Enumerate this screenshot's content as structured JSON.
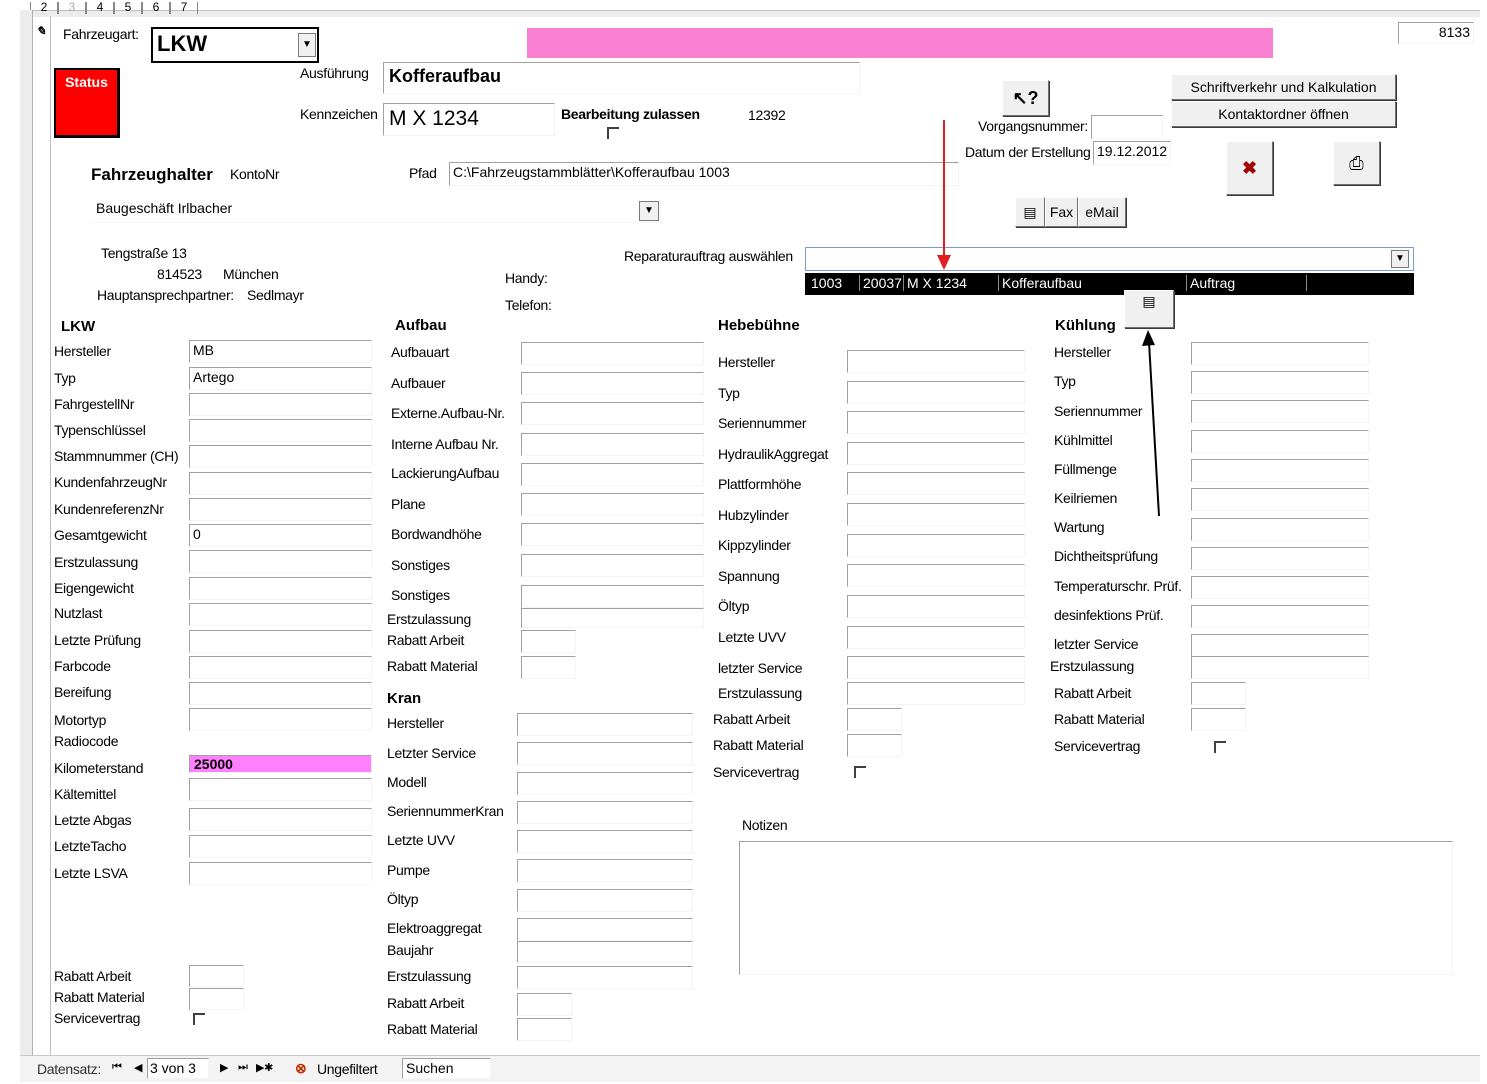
{
  "tabs": [
    "2",
    "3",
    "4",
    "5",
    "6",
    "7"
  ],
  "record_number": "8133",
  "header": {
    "fahrzeugart_label": "Fahrzeugart:",
    "fahrzeugart_value": "LKW",
    "status_label": "Status",
    "ausfuehrung_label": "Ausführung",
    "ausfuehrung_value": "Kofferaufbau",
    "kennzeichen_label": "Kennzeichen",
    "kennzeichen_value": "M X 1234",
    "bearbeitung_label": "Bearbeitung zulassen",
    "id_number": "12392",
    "vorgangsnummer_label": "Vorgangsnummer:",
    "datum_label": "Datum der Erstellung",
    "datum_value": "19.12.2012",
    "help_icon": "?",
    "schriftverkehr_label": "Schriftverkehr und Kalkulation",
    "kontaktordner_label": "Kontaktordner öffnen",
    "fax_label": "Fax",
    "email_label": "eMail"
  },
  "halter": {
    "title": "Fahrzeughalter",
    "kontonr_label": "KontoNr",
    "pfad_label": "Pfad",
    "pfad_value": "C:\\Fahrzeugstammblätter\\Kofferaufbau 1003",
    "name": "Baugeschäft Irlbacher",
    "street": "Tengstraße 13",
    "zip": "814523",
    "city": "München",
    "ansprech_label": "Hauptansprechpartner:",
    "ansprech_value": "Sedlmayr",
    "handy_label": "Handy:",
    "telefon_label": "Telefon:"
  },
  "reparatur": {
    "label": "Reparaturauftrag auswählen",
    "row": [
      "1003",
      "20037",
      "M X 1234",
      "Kofferaufbau",
      "Auftrag"
    ]
  },
  "lkw": {
    "title": "LKW",
    "fields": [
      {
        "label": "Hersteller",
        "value": "MB"
      },
      {
        "label": "Typ",
        "value": "Artego"
      },
      {
        "label": "FahrgestellNr",
        "value": ""
      },
      {
        "label": "Typenschlüssel",
        "value": ""
      },
      {
        "label": "Stammnummer (CH)",
        "value": ""
      },
      {
        "label": "KundenfahrzeugNr",
        "value": ""
      },
      {
        "label": "KundenreferenzNr",
        "value": ""
      },
      {
        "label": "Gesamtgewicht",
        "value": "0"
      },
      {
        "label": "Erstzulassung",
        "value": ""
      },
      {
        "label": "Eigengewicht",
        "value": ""
      },
      {
        "label": "Nutzlast",
        "value": ""
      },
      {
        "label": "Letzte Prüfung",
        "value": ""
      },
      {
        "label": "Farbcode",
        "value": ""
      },
      {
        "label": "Bereifung",
        "value": ""
      },
      {
        "label": "Motortyp",
        "value": ""
      },
      {
        "label": "Radiocode",
        "value": ""
      },
      {
        "label": "Kilometerstand",
        "value": "25000"
      },
      {
        "label": "Kältemittel",
        "value": ""
      },
      {
        "label": "Letzte Abgas",
        "value": ""
      },
      {
        "label": "LetzteTacho",
        "value": ""
      },
      {
        "label": "Letzte LSVA",
        "value": ""
      }
    ],
    "rabatt_arbeit": "Rabatt Arbeit",
    "rabatt_material": "Rabatt Material",
    "servicevertrag": "Servicevertrag"
  },
  "aufbau": {
    "title": "Aufbau",
    "fields": [
      "Aufbauart",
      "Aufbauer",
      "Externe.Aufbau-Nr.",
      "Interne Aufbau Nr.",
      "LackierungAufbau",
      "Plane",
      "Bordwandhöhe",
      "Sonstiges",
      "Sonstiges",
      "Erstzulassung",
      "Rabatt Arbeit",
      "Rabatt Material"
    ]
  },
  "kran": {
    "title": "Kran",
    "fields": [
      "Hersteller",
      "Letzter Service",
      "Modell",
      "SeriennummerKran",
      "Letzte UVV",
      "Pumpe",
      "Öltyp",
      "Elektroaggregat",
      "Baujahr",
      "Erstzulassung",
      "Rabatt Arbeit",
      "Rabatt Material"
    ]
  },
  "hebebuehne": {
    "title": "Hebebühne",
    "fields": [
      "Hersteller",
      "Typ",
      "Seriennummer",
      "HydraulikAggregat",
      "Plattformhöhe",
      "Hubzylinder",
      "Kippzylinder",
      "Spannung",
      "Öltyp",
      "Letzte UVV",
      "letzter Service",
      "Erstzulassung",
      "Rabatt Arbeit",
      "Rabatt Material",
      "Servicevertrag"
    ]
  },
  "kuehlung": {
    "title": "Kühlung",
    "fields": [
      "Hersteller",
      "Typ",
      "Seriennummer",
      "Kühlmittel",
      "Füllmenge",
      "Keilriemen",
      "Wartung",
      "Dichtheitsprüfung",
      "Temperaturschr. Prüf.",
      "desinfektions Prüf.",
      "letzter Service",
      "Erstzulassung",
      "Rabatt Arbeit",
      "Rabatt Material",
      "Servicevertrag"
    ]
  },
  "notizen_label": "Notizen",
  "nav": {
    "label": "Datensatz:",
    "position": "3 von 3",
    "filter": "Ungefiltert",
    "search": "Suchen"
  },
  "colors": {
    "status": "#ff0000",
    "pink": "#fa80d4",
    "km_bg": "#ff80ff",
    "arrow_red": "#e02020"
  }
}
